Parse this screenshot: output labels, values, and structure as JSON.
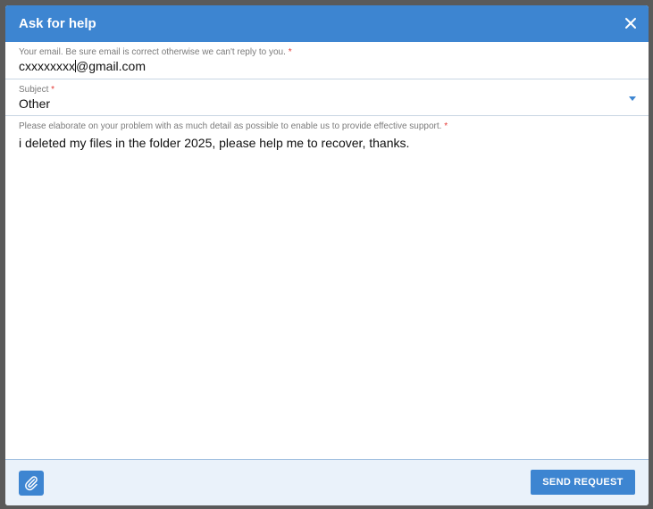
{
  "dialog": {
    "title": "Ask for help",
    "close_icon": "close-icon"
  },
  "email": {
    "label": "Your email. Be sure email is correct otherwise we can't reply to you.",
    "required_mark": "*",
    "value_before_cursor": "cxxxxxxxx",
    "value_after_cursor": "@gmail.com"
  },
  "subject": {
    "label": "Subject",
    "required_mark": "*",
    "selected": "Other",
    "dropdown_icon": "caret-down-icon"
  },
  "message": {
    "label": "Please elaborate on your problem with as much detail as possible to enable us to provide effective support.",
    "required_mark": "*",
    "value": "i deleted my files in the folder 2025, please help me to recover, thanks."
  },
  "footer": {
    "attach_icon": "paperclip-icon",
    "send_label": "SEND REQUEST"
  },
  "colors": {
    "accent": "#3d85d1",
    "required": "#e53935",
    "footer_bg": "#eaf2fa",
    "backdrop": "#5a5a5a"
  }
}
